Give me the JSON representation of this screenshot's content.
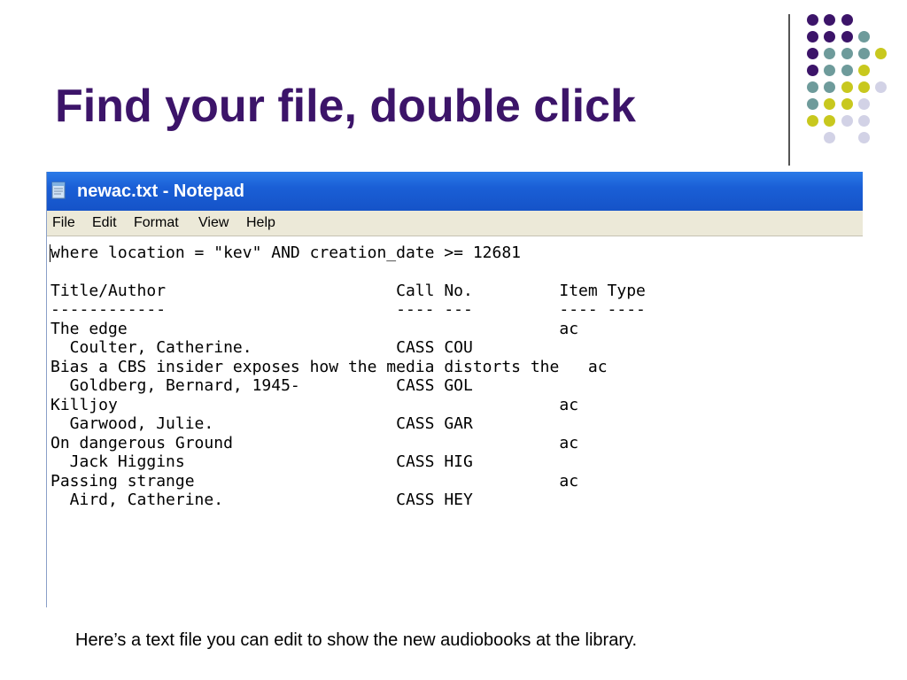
{
  "slide": {
    "title": "Find your file, double click",
    "caption": "Here’s a text file you can edit to show the new audiobooks at the library."
  },
  "notepad": {
    "window_title": "newac.txt - Notepad",
    "menu": [
      "File",
      "Edit",
      "Format",
      "View",
      "Help"
    ],
    "lines": [
      "where location = \"kev\" AND creation_date >= 12681",
      "",
      "Title/Author                        Call No.         Item Type",
      "------------                        ---- ---         ---- ----",
      "The edge                                             ac",
      "  Coulter, Catherine.               CASS COU",
      "Bias a CBS insider exposes how the media distorts the   ac",
      "  Goldberg, Bernard, 1945-          CASS GOL",
      "Killjoy                                              ac",
      "  Garwood, Julie.                   CASS GAR",
      "On dangerous Ground                                  ac",
      "  Jack Higgins                      CASS HIG",
      "Passing strange                                      ac",
      "  Aird, Catherine.                  CASS HEY"
    ]
  },
  "colors": {
    "title": "#3c1469",
    "dot_purple": "#3c1469",
    "dot_teal": "#6e9b9b",
    "dot_yellow": "#c8c81e",
    "dot_lavender": "#d2d2e6",
    "titlebar": "#1a5fd6",
    "menubar": "#ece9d8"
  }
}
